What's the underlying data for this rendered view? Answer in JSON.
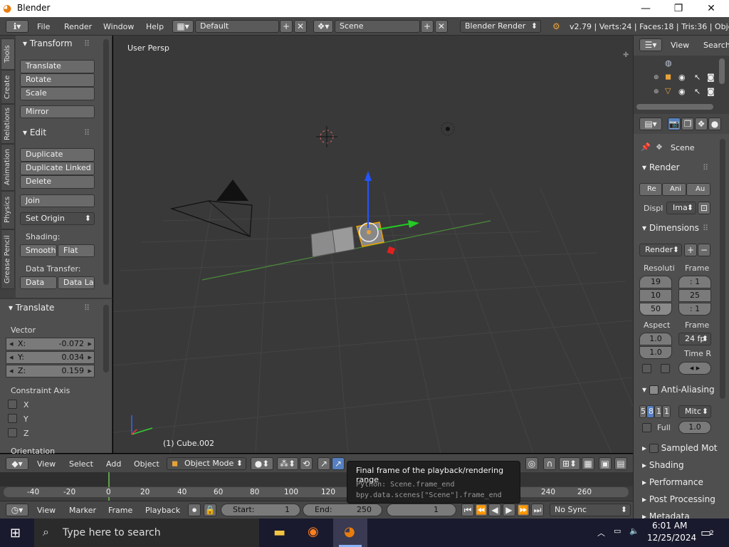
{
  "window": {
    "title": "Blender",
    "min": "—",
    "max": "❐",
    "close": "✕"
  },
  "info_header": {
    "menus": [
      "File",
      "Render",
      "Window",
      "Help"
    ],
    "layout": "Default",
    "scene": "Scene",
    "engine": "Blender Render",
    "stats": "v2.79 | Verts:24 | Faces:18 | Tris:36 | Objects"
  },
  "tool_tabs": [
    "Tools",
    "Create",
    "Relations",
    "Animation",
    "Physics",
    "Grease Pencil"
  ],
  "tools": {
    "transform_header": "Transform",
    "translate": "Translate",
    "rotate": "Rotate",
    "scale": "Scale",
    "mirror": "Mirror",
    "edit_header": "Edit",
    "duplicate": "Duplicate",
    "duplicate_linked": "Duplicate Linked",
    "delete": "Delete",
    "join": "Join",
    "set_origin": "Set Origin",
    "shading_label": "Shading:",
    "smooth": "Smooth",
    "flat": "Flat",
    "data_transfer_label": "Data Transfer:",
    "data": "Data",
    "data_layout": "Data La"
  },
  "operator": {
    "header": "Translate",
    "vector_label": "Vector",
    "x_label": "X:",
    "x": "-0.072",
    "y_label": "Y:",
    "y": "0.034",
    "z_label": "Z:",
    "z": "0.159",
    "constraint_label": "Constraint Axis",
    "cx": "X",
    "cy": "Y",
    "cz": "Z",
    "orientation": "Orientation"
  },
  "viewport": {
    "label": "User Persp",
    "object": "(1) Cube.002"
  },
  "view_header": {
    "menus": [
      "View",
      "Select",
      "Add",
      "Object"
    ],
    "mode": "Object Mode"
  },
  "timeline": {
    "ticks": [
      "-40",
      "-20",
      "0",
      "20",
      "40",
      "60",
      "80",
      "100",
      "120",
      "240",
      "260"
    ],
    "menus": [
      "View",
      "Marker",
      "Frame",
      "Playback"
    ],
    "start_label": "Start:",
    "start": "1",
    "end_label": "End:",
    "end": "250",
    "current": "1",
    "sync": "No Sync"
  },
  "tooltip": {
    "title": "Final frame of the playback/rendering range",
    "python1": "Python: Scene.frame_end",
    "python2": "bpy.data.scenes[\"Scene\"].frame_end"
  },
  "outliner": {
    "view": "View",
    "search": "Search"
  },
  "properties": {
    "scene": "Scene",
    "render_header": "Render",
    "render_btns": [
      "Re",
      "Ani",
      "Au"
    ],
    "display_label": "Displ",
    "display_val": "Ima",
    "dimensions_header": "Dimensions",
    "preset": "Render",
    "resolution_label": "Resoluti",
    "frame_label": "Frame",
    "res_x": "19",
    "res_y": "10",
    "res_pct": "50",
    "frame_start": ": 1",
    "frame_end": "25",
    "frame_step": ": 1",
    "aspect_label": "Aspect",
    "frame_rate_label": "Frame",
    "aspect_x": "1.0",
    "aspect_y": "1.0",
    "fps": "24 fp",
    "time_remap_label": "Time R",
    "aa_header": "Anti-Aliasing",
    "aa_samples": [
      "5",
      "8",
      "1",
      "1"
    ],
    "aa_filter": "Mitc",
    "full_label": "Full",
    "full_val": "1.0",
    "sampled_motion": "Sampled Mot",
    "shading": "Shading",
    "performance": "Performance",
    "post_processing": "Post Processing",
    "metadata": "Metadata"
  },
  "taskbar": {
    "search_placeholder": "Type here to search",
    "time": "6:01 AM",
    "date": "12/25/2024",
    "notif": "2"
  }
}
